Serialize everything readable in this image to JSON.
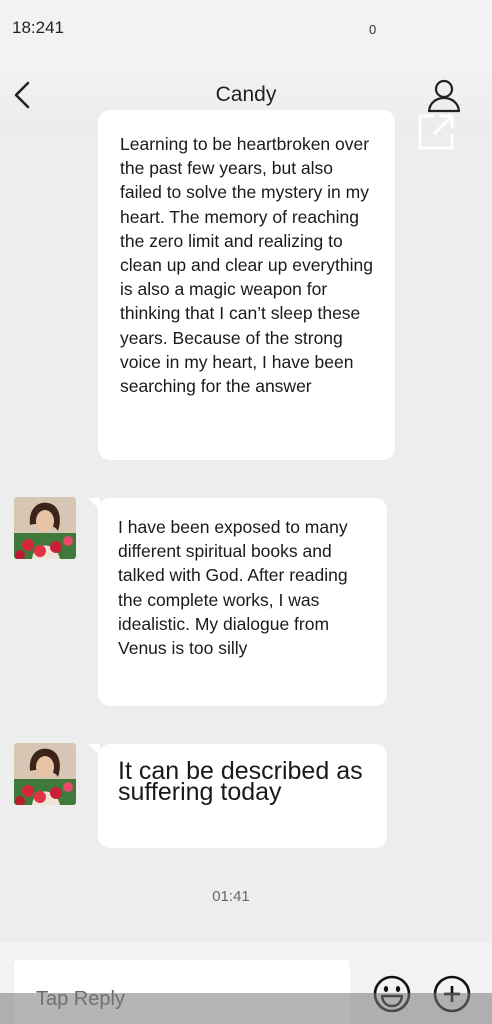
{
  "status_bar": {
    "time": "18:241",
    "right_text": "0"
  },
  "header": {
    "title": "Candy"
  },
  "messages": [
    {
      "text": "Learning to be heartbroken over the past few years, but also failed to solve the mystery in my heart. The memory of reaching the zero limit and realizing to clean up and clear up everything is also a magic weapon for thinking that I can’t sleep these years. Because of the strong voice in my heart, I have been searching for the answer"
    },
    {
      "text": "I have been exposed to many different spiritual books and talked with God. After reading the complete works, I was idealistic. My dialogue from Venus is too silly"
    },
    {
      "text": "It can be described as suffering today"
    }
  ],
  "timestamp": "01:41",
  "input": {
    "placeholder": "Tap Reply"
  },
  "colors": {
    "background": "#ededed",
    "bubble": "#ffffff",
    "header": "#f3f3f3"
  },
  "icons": [
    "back-arrow-icon",
    "profile-icon",
    "share-icon",
    "emoji-icon",
    "plus-icon"
  ]
}
